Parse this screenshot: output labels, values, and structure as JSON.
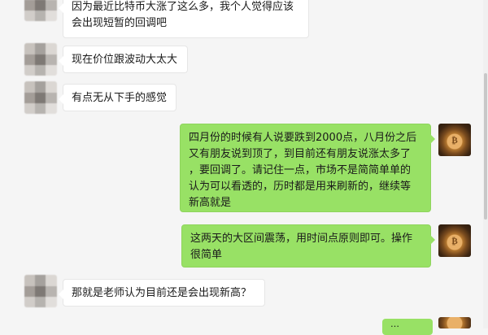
{
  "messages": [
    {
      "side": "left",
      "text": "因为最近比特币大涨了这么多，我个人觉得应该\n会出现短暂的回调吧"
    },
    {
      "side": "left",
      "text": "现在价位跟波动大太大"
    },
    {
      "side": "left",
      "text": "有点无从下手的感觉"
    },
    {
      "side": "right",
      "text": "四月份的时候有人说要跌到2000点，八月份之后\n又有朋友说到顶了，到目前还有朋友说涨太多了\n，要回调了。请记住一点，市场不是简简单单的\n认为可以看透的，历时都是用来刷新的，继续等\n新高就是"
    },
    {
      "side": "right",
      "text": "这两天的大区间震荡，用时间点原则即可。操作\n很简单"
    },
    {
      "side": "left",
      "text": "那就是老师认为目前还是会出现新高？"
    },
    {
      "side": "right",
      "text": "…"
    }
  ],
  "self_avatar_glyph": "₿",
  "colors": {
    "background": "#f5f5f5",
    "incoming_bubble": "#ffffff",
    "outgoing_bubble": "#98e165"
  },
  "icons": {
    "contact_avatar": "blurred-avatar-icon",
    "self_avatar": "bitcoin-avatar-icon"
  }
}
